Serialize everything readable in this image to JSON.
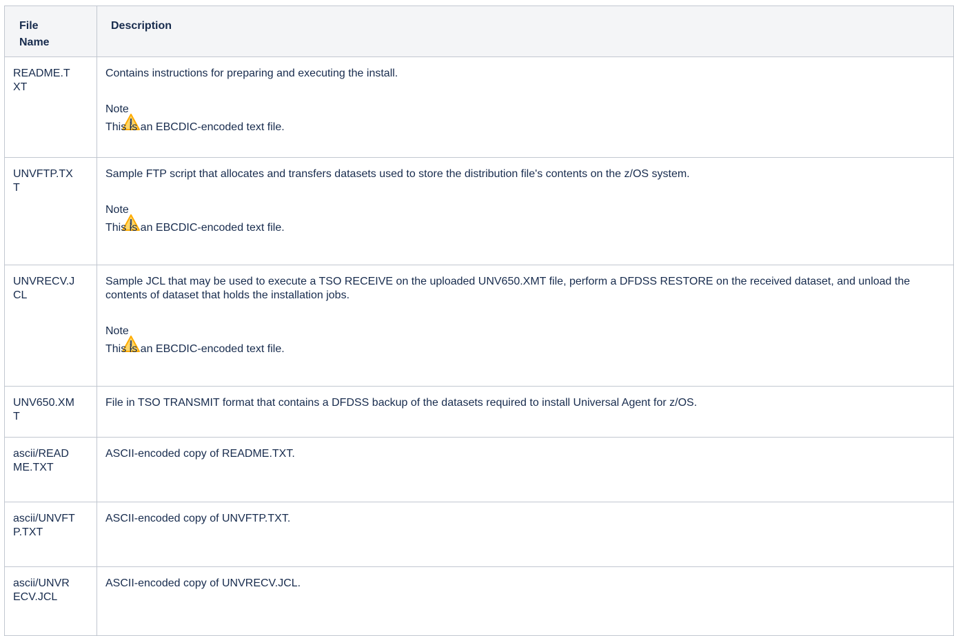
{
  "table": {
    "headers": {
      "file_name": "File Name",
      "description": "Description"
    },
    "rows": [
      {
        "file": "README.TXT",
        "desc": "Contains instructions for preparing and executing the install.",
        "note_title": "Note",
        "note_body": "This is an EBCDIC-encoded text file."
      },
      {
        "file": "UNVFTP.TXT",
        "desc": "Sample FTP script that allocates and transfers datasets used to store the distribution file's contents on the z/OS system.",
        "note_title": "Note",
        "note_body": "This is an EBCDIC-encoded text file."
      },
      {
        "file": "UNVRECV.JCL",
        "desc": "Sample JCL that may be used to execute a TSO RECEIVE on the uploaded UNV650.XMT file, perform a DFDSS RESTORE on the received dataset, and unload the contents of dataset that holds the installation jobs.",
        "note_title": "Note",
        "note_body": "This is an EBCDIC-encoded text file."
      },
      {
        "file": "UNV650.XMT",
        "desc": "File in TSO TRANSMIT format that contains a DFDSS backup of the datasets required to install Universal Agent for z/OS."
      },
      {
        "file": "ascii/README.TXT",
        "desc": "ASCII-encoded copy of README.TXT."
      },
      {
        "file": "ascii/UNVFTP.TXT",
        "desc": "ASCII-encoded copy of UNVFTP.TXT."
      },
      {
        "file": "ascii/UNVRECV.JCL",
        "desc": "ASCII-encoded copy of UNVRECV.JCL."
      }
    ],
    "note_icon": "warning-icon",
    "note_icon_color": "#ffab00"
  }
}
